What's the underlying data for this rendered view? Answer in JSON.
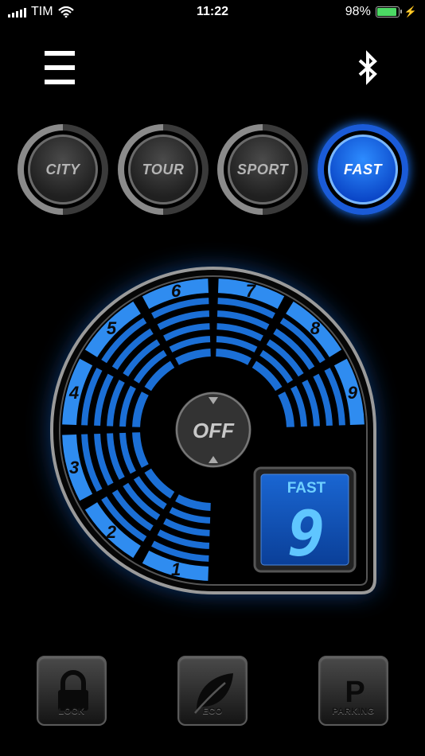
{
  "status_bar": {
    "carrier": "TIM",
    "time": "11:22",
    "battery": "98%",
    "battery_level": 0.98
  },
  "modes": [
    {
      "label": "CITY",
      "active": false
    },
    {
      "label": "TOUR",
      "active": false
    },
    {
      "label": "SPORT",
      "active": false
    },
    {
      "label": "FAST",
      "active": true
    }
  ],
  "dial": {
    "center_label": "OFF",
    "levels": [
      "1",
      "2",
      "3",
      "4",
      "5",
      "6",
      "7",
      "8",
      "9"
    ],
    "current_level": 9,
    "display_mode": "FAST",
    "display_value": "9"
  },
  "bottom_buttons": {
    "lock": "LOCK",
    "eco": "ECO",
    "parking": "PARKING",
    "parking_letter": "P"
  },
  "colors": {
    "accent": "#1f7bff",
    "segment": "#1b6fd6",
    "segment_bright": "#2f8cf0",
    "display_bg": "#0d4fb3",
    "display_text": "#5fc6ff"
  }
}
